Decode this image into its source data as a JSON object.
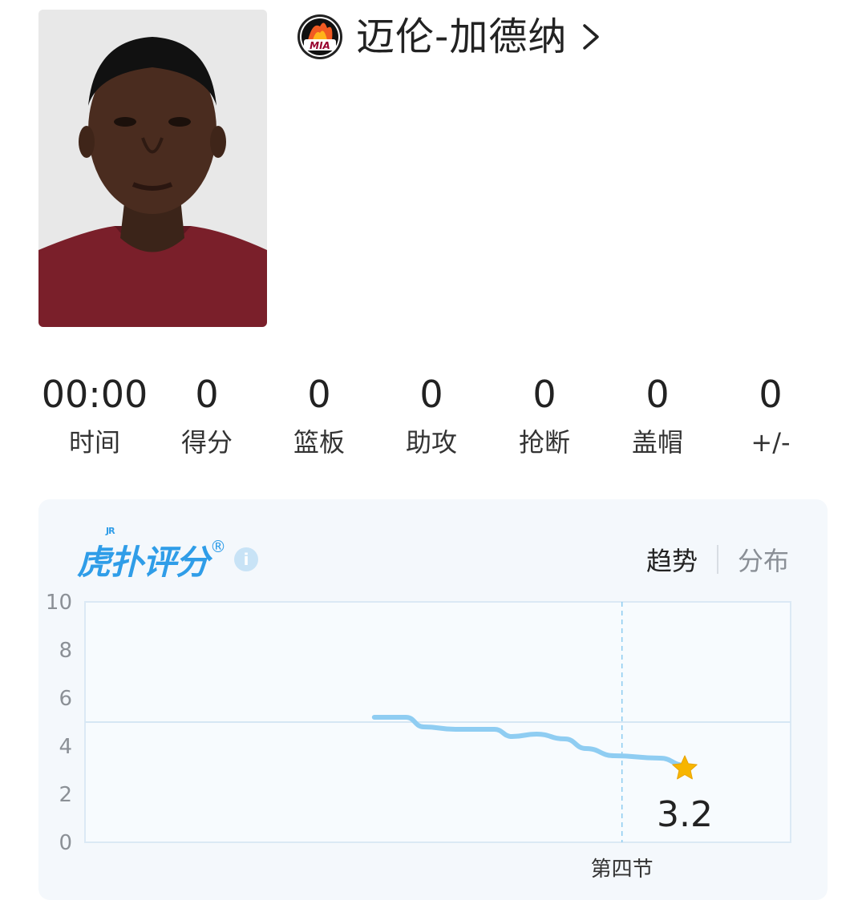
{
  "player": {
    "name": "迈伦-加德纳",
    "team_logo_text": "MIA",
    "team_color": "#98002e"
  },
  "stats": [
    {
      "value": "00:00",
      "label": "时间"
    },
    {
      "value": "0",
      "label": "得分"
    },
    {
      "value": "0",
      "label": "篮板"
    },
    {
      "value": "0",
      "label": "助攻"
    },
    {
      "value": "0",
      "label": "抢断"
    },
    {
      "value": "0",
      "label": "盖帽"
    },
    {
      "value": "0",
      "label": "+/-"
    }
  ],
  "rating": {
    "brand": "虎扑评分",
    "brand_small": "JR",
    "brand_reg": "®",
    "info_icon": "info-icon",
    "tabs": {
      "active": "趋势",
      "inactive": "分布"
    },
    "current_score": "3.2",
    "marker_icon": "star-icon",
    "accent": "#2f9de8",
    "line_color": "#8fcdf2",
    "star_color": "#f7b500"
  },
  "chart_data": {
    "type": "line",
    "ylim": [
      0,
      10
    ],
    "yticks": [
      "0",
      "2",
      "4",
      "6",
      "8",
      "10"
    ],
    "x_marker_label": "第四节",
    "series": [
      {
        "values": [
          [
            0.41,
            5.2
          ],
          [
            0.455,
            5.2
          ],
          [
            0.48,
            4.8
          ],
          [
            0.525,
            4.7
          ],
          [
            0.58,
            4.7
          ],
          [
            0.605,
            4.4
          ],
          [
            0.64,
            4.5
          ],
          [
            0.68,
            4.3
          ],
          [
            0.71,
            3.9
          ],
          [
            0.75,
            3.6
          ],
          [
            0.815,
            3.5
          ],
          [
            0.85,
            3.2
          ]
        ]
      }
    ]
  }
}
